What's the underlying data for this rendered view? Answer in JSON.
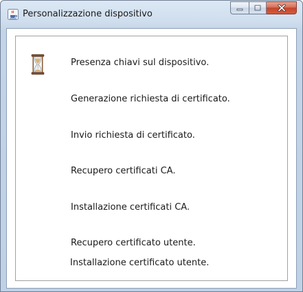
{
  "window": {
    "title": "Personalizzazione dispositivo",
    "icon": "java-cup-icon",
    "controls": {
      "minimize_icon": "minimize-icon",
      "maximize_icon": "maximize-icon",
      "close_icon": "close-icon",
      "close_color": "#c4452b"
    }
  },
  "progress": {
    "busy_icon": "hourglass-icon",
    "steps": [
      "Presenza chiavi sul dispositivo.",
      "Generazione richiesta di certificato.",
      "Invio richiesta di certificato.",
      "Recupero certificati CA.",
      "Installazione certificati CA.",
      "Recupero certificato utente.",
      "Installazione certificato utente."
    ]
  }
}
